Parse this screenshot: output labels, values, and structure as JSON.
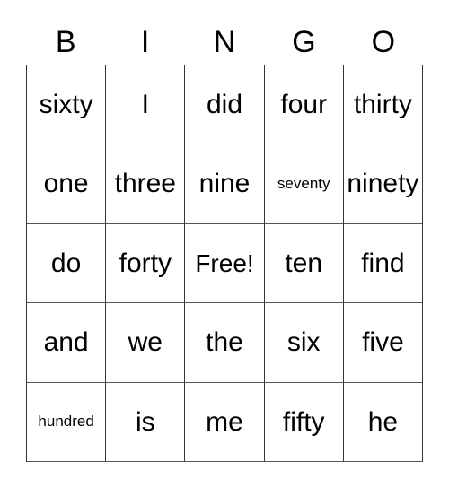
{
  "card": {
    "title_letters": [
      "B",
      "I",
      "N",
      "G",
      "O"
    ],
    "rows": [
      [
        {
          "text": "sixty",
          "size": "normal"
        },
        {
          "text": "I",
          "size": "normal"
        },
        {
          "text": "did",
          "size": "normal"
        },
        {
          "text": "four",
          "size": "normal"
        },
        {
          "text": "thirty",
          "size": "normal"
        }
      ],
      [
        {
          "text": "one",
          "size": "normal"
        },
        {
          "text": "three",
          "size": "normal"
        },
        {
          "text": "nine",
          "size": "normal"
        },
        {
          "text": "seventy",
          "size": "small"
        },
        {
          "text": "ninety",
          "size": "normal"
        }
      ],
      [
        {
          "text": "do",
          "size": "normal"
        },
        {
          "text": "forty",
          "size": "normal"
        },
        {
          "text": "Free!",
          "size": "medium"
        },
        {
          "text": "ten",
          "size": "normal"
        },
        {
          "text": "find",
          "size": "normal"
        }
      ],
      [
        {
          "text": "and",
          "size": "normal"
        },
        {
          "text": "we",
          "size": "normal"
        },
        {
          "text": "the",
          "size": "normal"
        },
        {
          "text": "six",
          "size": "normal"
        },
        {
          "text": "five",
          "size": "normal"
        }
      ],
      [
        {
          "text": "hundred",
          "size": "small"
        },
        {
          "text": "is",
          "size": "normal"
        },
        {
          "text": "me",
          "size": "normal"
        },
        {
          "text": "fifty",
          "size": "normal"
        },
        {
          "text": "he",
          "size": "normal"
        }
      ]
    ],
    "free_space_label": "Free!",
    "colors": {
      "background": "#ffffff",
      "cell_background": "#ffffff",
      "border": "#333333",
      "text": "#000000"
    }
  }
}
